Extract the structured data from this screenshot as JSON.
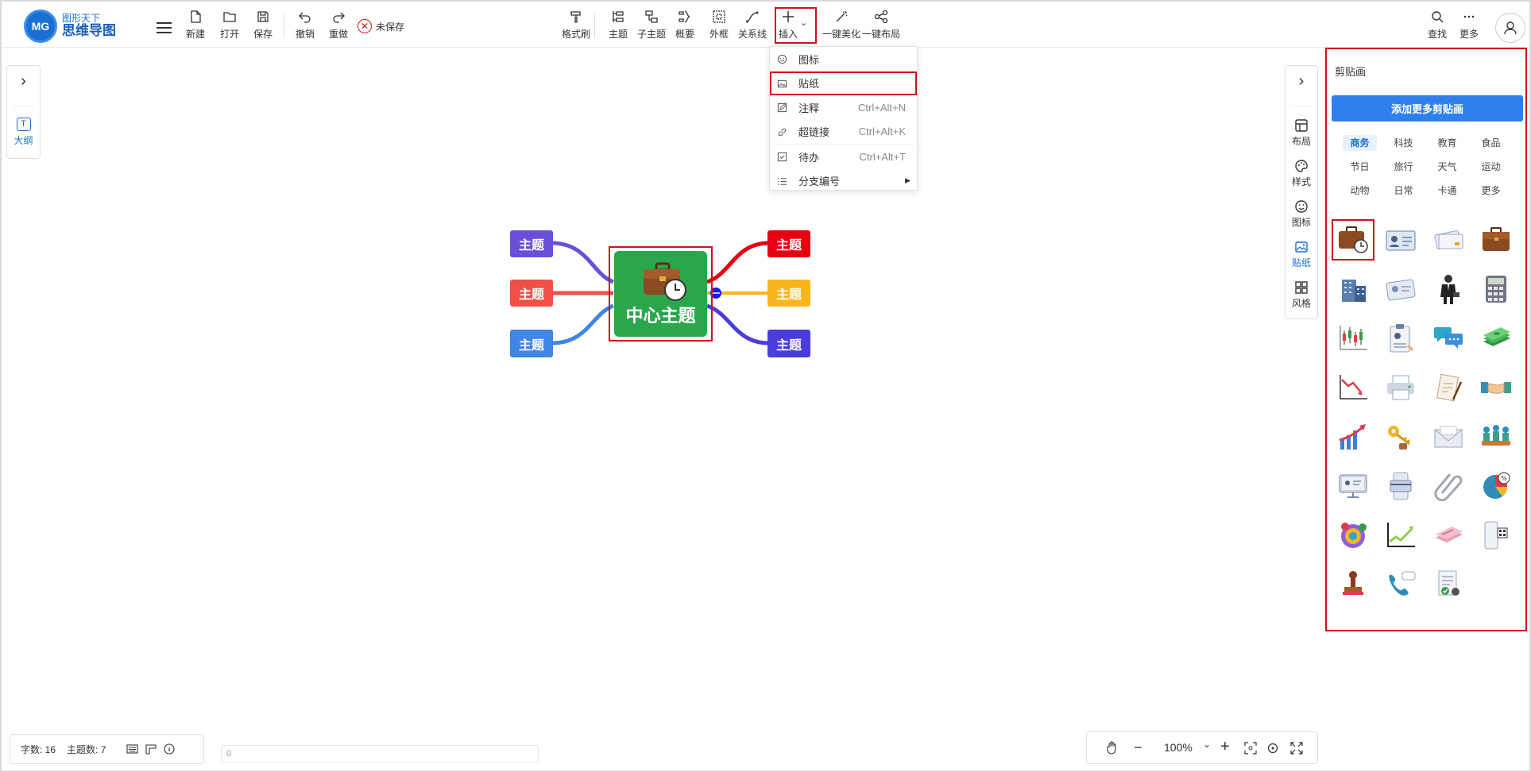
{
  "app": {
    "logo_mark": "MG",
    "logo_small": "图形天下",
    "logo_big": "思维导图"
  },
  "toolbar": {
    "new": "新建",
    "open": "打开",
    "save": "保存",
    "undo": "撤销",
    "redo": "重做",
    "unsaved": "未保存",
    "format_brush": "格式刷",
    "topic": "主题",
    "subtopic": "子主题",
    "summary": "概要",
    "boundary": "外框",
    "relation": "关系线",
    "insert": "插入",
    "beautify": "一键美化",
    "layout": "一键布局",
    "find": "查找",
    "more": "更多"
  },
  "insert_menu": [
    {
      "label": "图标",
      "shortcut": "",
      "icon": "smile-icon"
    },
    {
      "label": "贴纸",
      "shortcut": "",
      "icon": "image-icon",
      "highlighted": true
    },
    {
      "label": "注释",
      "shortcut": "Ctrl+Alt+N",
      "icon": "note-icon"
    },
    {
      "label": "超链接",
      "shortcut": "Ctrl+Alt+K",
      "icon": "link-icon"
    },
    {
      "label": "待办",
      "shortcut": "Ctrl+Alt+T",
      "icon": "checkbox-icon"
    },
    {
      "label": "分支编号",
      "shortcut": "",
      "icon": "numbered-list-icon",
      "submenu": true
    }
  ],
  "left_panel": {
    "outline": "大纲",
    "outline_icon": "T"
  },
  "right_tabs": {
    "layout": "布局",
    "style": "样式",
    "icon": "图标",
    "sticker": "贴纸",
    "theme": "风格"
  },
  "clipart": {
    "title": "剪贴画",
    "add_button": "添加更多剪贴画",
    "categories": [
      "商务",
      "科技",
      "教育",
      "食品",
      "节日",
      "旅行",
      "天气",
      "运动",
      "动物",
      "日常",
      "卡通",
      "更多"
    ],
    "active_category": "商务",
    "items": [
      "briefcase-clock",
      "id-card",
      "business-cards",
      "briefcase",
      "office-building",
      "id-badge",
      "businessman",
      "calculator",
      "candlestick-chart",
      "resume-clipboard",
      "chat-bubbles",
      "money-stack",
      "declining-chart",
      "printer",
      "contract-pen",
      "handshake",
      "growth-arrow",
      "keys",
      "envelope",
      "team-meeting",
      "presentation-screen",
      "payment-phone",
      "paperclip",
      "pie-chart-percent",
      "target-coins",
      "line-graph",
      "cash-bundle",
      "mobile-qr",
      "stamp",
      "telephone",
      "approved-document"
    ]
  },
  "mindmap": {
    "center": "中心主题",
    "left_topics": [
      "主题",
      "主题",
      "主题"
    ],
    "right_topics": [
      "主题",
      "主题",
      "主题"
    ],
    "colors": {
      "left1": "#6a4fd9",
      "left2": "#ef5048",
      "left3": "#3f86e6",
      "right1": "#e60012",
      "right2": "#f9b51c",
      "right3": "#4b3ddb",
      "center": "#2aa74c"
    }
  },
  "status": {
    "word_count": "字数: 16",
    "topic_count": "主题数: 7",
    "input_value": "0",
    "zoom": "100%"
  }
}
